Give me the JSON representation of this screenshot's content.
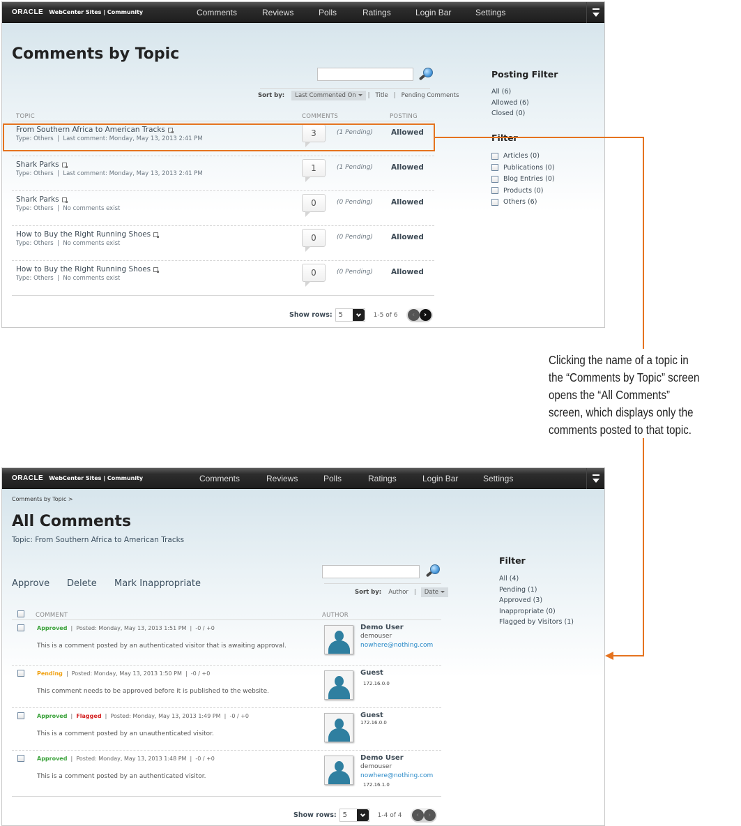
{
  "app": {
    "brand_logo": "ORACLE",
    "brand_text": "WebCenter Sites | Community",
    "nav": [
      "Comments",
      "Reviews",
      "Polls",
      "Ratings",
      "Login Bar",
      "Settings"
    ],
    "menu_icon": "menu-dropdown-icon"
  },
  "comments_by_topic": {
    "title": "Comments by Topic",
    "search": {
      "value": "",
      "placeholder": ""
    },
    "sort": {
      "label": "Sort by:",
      "options": [
        "Last Commented On",
        "Title",
        "Pending Comments"
      ],
      "active": "Last Commented On"
    },
    "columns": [
      "TOPIC",
      "COMMENTS",
      "POSTING"
    ],
    "rows": [
      {
        "title": "From Southern Africa to American Tracks",
        "type": "Type: Others",
        "meta": "Last comment: Monday, May 13, 2013 2:41 PM",
        "count": "3",
        "pending": "(1 Pending)",
        "posting": "Allowed",
        "highlighted": true
      },
      {
        "title": "Shark Parks",
        "type": "Type: Others",
        "meta": "Last comment: Monday, May 13, 2013 2:41 PM",
        "count": "1",
        "pending": "(1 Pending)",
        "posting": "Allowed"
      },
      {
        "title": "Shark Parks",
        "type": "Type: Others",
        "meta": "No comments exist",
        "count": "0",
        "pending": "(0 Pending)",
        "posting": "Allowed"
      },
      {
        "title": "How to Buy the Right Running Shoes",
        "type": "Type: Others",
        "meta": "No comments exist",
        "count": "0",
        "pending": "(0 Pending)",
        "posting": "Allowed"
      },
      {
        "title": "How to Buy the Right Running Shoes",
        "type": "Type: Others",
        "meta": "No comments exist",
        "count": "0",
        "pending": "(0 Pending)",
        "posting": "Allowed"
      }
    ],
    "pager": {
      "label": "Show rows:",
      "rows": "5",
      "range": "1-5 of 6",
      "prev": "‹",
      "next": "›"
    },
    "posting_filter": {
      "heading": "Posting Filter",
      "items": [
        "All (6)",
        "Allowed (6)",
        "Closed (0)"
      ]
    },
    "filter": {
      "heading": "Filter",
      "items": [
        "Articles (0)",
        "Publications (0)",
        "Blog Entries (0)",
        "Products (0)",
        "Others (6)"
      ]
    }
  },
  "annotation": {
    "lines": [
      "Clicking the name of a topic in",
      "the “Comments by Topic” screen",
      "opens the “All Comments”",
      "screen, which displays only the",
      "comments posted to that topic."
    ],
    "accent": "#e5731f"
  },
  "all_comments": {
    "breadcrumb": "Comments by Topic  >",
    "title": "All Comments",
    "subtitle": "Topic: From Southern Africa to American Tracks",
    "actions": [
      "Approve",
      "Delete",
      "Mark Inappropriate"
    ],
    "search": {
      "value": "",
      "placeholder": ""
    },
    "sort": {
      "label": "Sort by:",
      "options": [
        "Author",
        "Date"
      ],
      "active": "Date"
    },
    "columns": [
      "COMMENT",
      "AUTHOR"
    ],
    "rows": [
      {
        "status": "Approved",
        "flag": "",
        "posted": "Posted: Monday, May 13, 2013 1:51 PM",
        "votes": "-0 / +0",
        "text": "This is a comment posted by an authenticated visitor that is awaiting approval.",
        "author": "Demo User",
        "username": "demouser",
        "email": "nowhere@nothing.com",
        "ip": ""
      },
      {
        "status": "Pending",
        "flag": "",
        "posted": "Posted: Monday, May 13, 2013 1:50 PM",
        "votes": "-0 / +0",
        "text": "This comment needs to be approved before it is published to the website.",
        "author": "Guest",
        "username": "",
        "email": "",
        "ip": "172.16.0.0"
      },
      {
        "status": "Approved",
        "flag": "Flagged",
        "posted": "Posted: Monday, May 13, 2013 1:49 PM",
        "votes": "-0 / +0",
        "text": "This is a comment posted by an unauthenticated visitor.",
        "author": "Guest",
        "username": "",
        "email": "",
        "ip": "172.16.0.0"
      },
      {
        "status": "Approved",
        "flag": "",
        "posted": "Posted: Monday, May 13, 2013 1:48 PM",
        "votes": "-0 / +0",
        "text": "This is a comment posted by an authenticated visitor.",
        "author": "Demo User",
        "username": "demouser",
        "email": "nowhere@nothing.com",
        "ip": "172.16.1.0"
      }
    ],
    "pager": {
      "label": "Show rows:",
      "rows": "5",
      "range": "1-4 of 4",
      "prev": "‹",
      "next": "›"
    },
    "filter": {
      "heading": "Filter",
      "items": [
        "All (4)",
        "Pending (1)",
        "Approved (3)",
        "Inappropriate (0)",
        "Flagged by Visitors (1)"
      ]
    },
    "status_colors": {
      "Approved": "#3aa23a",
      "Pending": "#f0a010",
      "Flagged": "#d42020"
    }
  }
}
